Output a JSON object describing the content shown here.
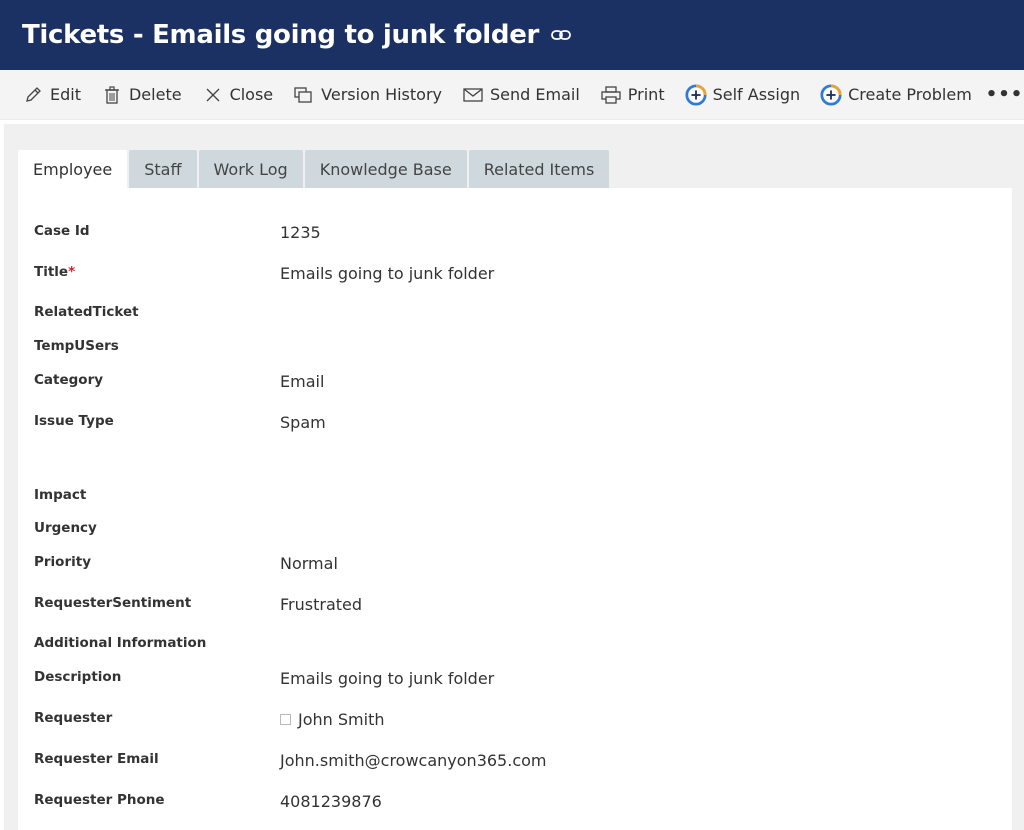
{
  "header": {
    "title": "Tickets - Emails going to junk folder",
    "link_icon": "link-icon"
  },
  "toolbar": {
    "edit": "Edit",
    "delete": "Delete",
    "close": "Close",
    "version_history": "Version History",
    "send_email": "Send Email",
    "print": "Print",
    "self_assign": "Self Assign",
    "create_problem": "Create Problem",
    "more": "•••"
  },
  "tabs": [
    "Employee",
    "Staff",
    "Work Log",
    "Knowledge Base",
    "Related Items"
  ],
  "fields": {
    "case_id": {
      "label": "Case Id",
      "value": "1235"
    },
    "title": {
      "label": "Title",
      "required": "*",
      "value": "Emails going to junk folder"
    },
    "related_ticket": {
      "label": "RelatedTicket"
    },
    "temp_users": {
      "label": "TempUSers"
    },
    "category": {
      "label": "Category",
      "value": "Email"
    },
    "issue_type": {
      "label": "Issue Type",
      "value": "Spam"
    },
    "impact": {
      "label": "Impact"
    },
    "urgency": {
      "label": "Urgency"
    },
    "priority": {
      "label": "Priority",
      "value": "Normal"
    },
    "requester_sentiment": {
      "label": "RequesterSentiment",
      "value": "Frustrated"
    },
    "additional_information": {
      "label": "Additional Information"
    },
    "description": {
      "label": "Description",
      "value": "Emails going to junk folder"
    },
    "requester": {
      "label": "Requester",
      "value": "John Smith"
    },
    "requester_email": {
      "label": "Requester Email",
      "value": "John.smith@crowcanyon365.com"
    },
    "requester_phone": {
      "label": "Requester Phone",
      "value": "4081239876"
    }
  },
  "colors": {
    "header_bg": "#1c3163",
    "required": "#c4262e",
    "tab_bg": "#cfd8dc"
  }
}
